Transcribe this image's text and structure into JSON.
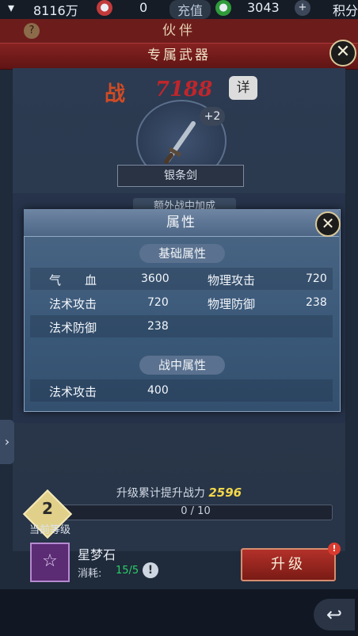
{
  "topbar": {
    "silver": "8116万",
    "coin": "0",
    "recharge_label": "充值",
    "gem": "3043",
    "add": "+",
    "points_label": "积分"
  },
  "partner_title": "伙伴",
  "weapon_title": "专属武器",
  "close_glyph": "✕",
  "power": {
    "label": "战",
    "value": "7188",
    "detail_label": "详"
  },
  "weapon": {
    "plus": "+2",
    "name": "银条剑"
  },
  "extra_label": "额外战中加成",
  "modal": {
    "title": "属性",
    "base_section": "基础属性",
    "base_rows": [
      {
        "label1": "气　　血",
        "val1": "3600",
        "label2": "物理攻击",
        "val2": "720"
      },
      {
        "label1": "法术攻击",
        "val1": "720",
        "label2": "物理防御",
        "val2": "238"
      },
      {
        "label1": "法术防御",
        "val1": "238",
        "label2": "",
        "val2": ""
      }
    ],
    "battle_section": "战中属性",
    "battle_rows": [
      {
        "label1": "法术攻击",
        "val1": "400"
      }
    ]
  },
  "upgrade": {
    "note": "升级累计提升战力",
    "gain": "2596",
    "level": "2",
    "level_label": "当前等级",
    "progress_text": "0 / 10",
    "progress": 0
  },
  "material": {
    "name": "星梦石",
    "cost_label": "消耗:",
    "cost": "15/5",
    "button": "升级",
    "alert": "!"
  },
  "nav": {
    "back": "↩",
    "side": "›"
  }
}
